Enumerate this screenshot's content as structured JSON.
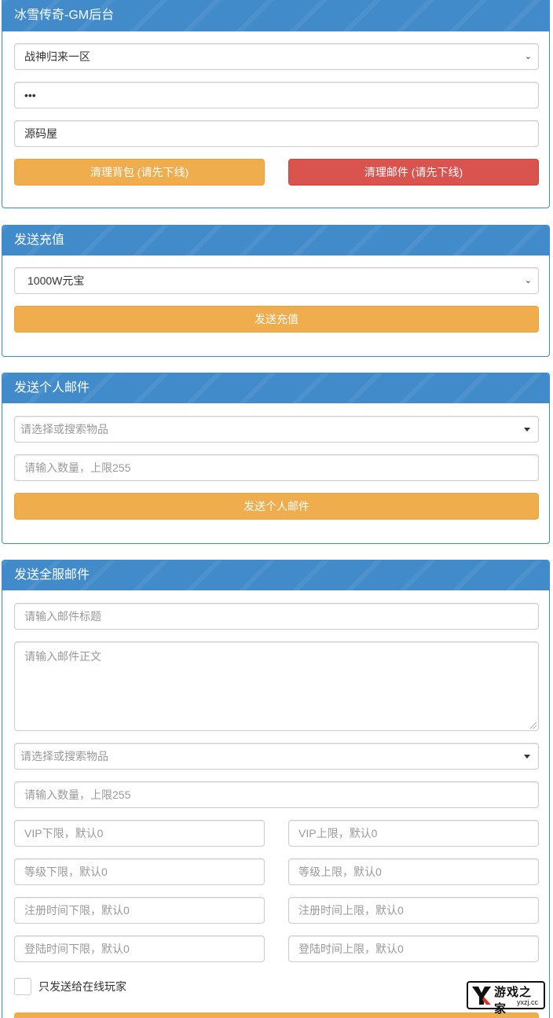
{
  "gm_panel": {
    "title": "冰雪传奇-GM后台",
    "server_select": "战神归来一区",
    "password_value": "•••",
    "account_value": "源码屋",
    "clear_bag_label": "清理背包 (请先下线)",
    "clear_mail_label": "清理邮件 (请先下线)"
  },
  "recharge_panel": {
    "title": "发送充值",
    "amount_select": "1000W元宝",
    "send_label": "发送充值"
  },
  "personal_mail_panel": {
    "title": "发送个人邮件",
    "item_placeholder": "请选择或搜索物品",
    "quantity_placeholder": "请输入数量，上限255",
    "send_label": "发送个人邮件"
  },
  "server_mail_panel": {
    "title": "发送全服邮件",
    "subject_placeholder": "请输入邮件标题",
    "body_placeholder": "请输入邮件正文",
    "item_placeholder": "请选择或搜索物品",
    "quantity_placeholder": "请输入数量，上限255",
    "vip_min_placeholder": "VIP下限，默认0",
    "vip_max_placeholder": "VIP上限，默认0",
    "level_min_placeholder": "等级下限，默认0",
    "level_max_placeholder": "等级上限，默认0",
    "reg_min_placeholder": "注册时间下限，默认0",
    "reg_max_placeholder": "注册时间上限，默认0",
    "login_min_placeholder": "登陆时间下限，默认0",
    "login_max_placeholder": "登陆时间上限，默认0",
    "online_only_label": "只发送给在线玩家"
  },
  "watermark_logo": {
    "brand": "游戏之家",
    "domain": "yxzj.cc"
  },
  "colors": {
    "header_blue": "#428bca",
    "warning": "#f0ad4e",
    "danger": "#d9534f",
    "border": "#cccccc"
  }
}
